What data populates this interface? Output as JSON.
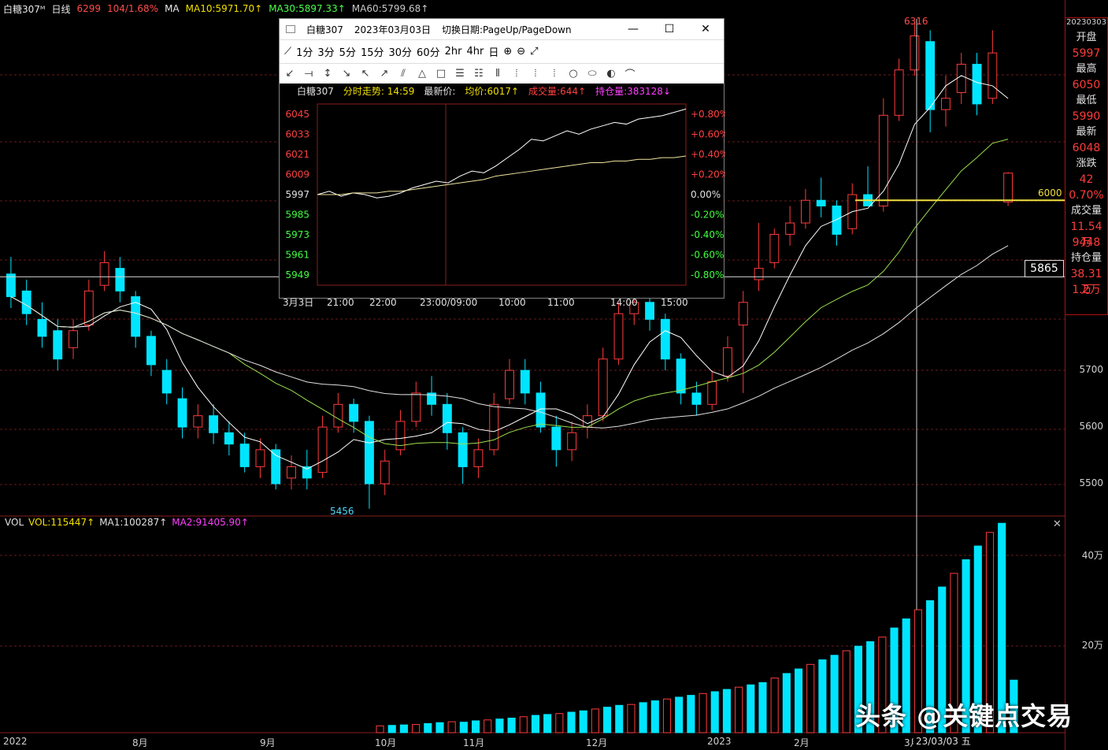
{
  "toolbar": {
    "symbol": "白糖307ᴹ",
    "period": "日线",
    "price": "6299",
    "change": "104/1.68%",
    "ma_label": "MA",
    "ma10": "MA10:5971.70↑",
    "ma30": "MA30:5897.33↑",
    "ma60": "MA60:5799.68↑"
  },
  "info_panel": {
    "date": "20230303",
    "open_label": "开盘",
    "open": "5997",
    "high_label": "最高",
    "high": "6050",
    "low_label": "最低",
    "low": "5990",
    "last_label": "最新",
    "last": "6048",
    "chg_label": "涨跌",
    "chg": "42",
    "pct": "0.70%",
    "vol_label": "成交量",
    "vol": "11.54万",
    "vol2": "9448",
    "oi_label": "持仓量",
    "oi": "38.31万",
    "oi2": "1.2万"
  },
  "price_axis": [
    "5700",
    "5600",
    "5500"
  ],
  "cursor_price": "5865",
  "level_label": "6000",
  "high_marker": "6316",
  "low_marker": "5456",
  "volume": {
    "label": "VOL",
    "vol": "VOL:115447↑",
    "ma1": "MA1:100287↑",
    "ma2": "MA2:91405.90↑",
    "axis": [
      "40万",
      "20万"
    ]
  },
  "x_axis": [
    "2022",
    "8月",
    "9月",
    "10月",
    "11月",
    "12月",
    "2023",
    "2月",
    "3月"
  ],
  "x_cursor": "23/03/03 五",
  "watermark": "头条 @关键点交易",
  "popup": {
    "title_symbol": "白糖307",
    "title_date": "2023年03月03日",
    "title_hint": "切换日期:PageUp/PageDown",
    "timeframes": [
      "1分",
      "3分",
      "5分",
      "15分",
      "30分",
      "60分",
      "2hr",
      "4hr",
      "日"
    ],
    "info_symbol": "白糖307",
    "info_trend": "分时走势: 14:59",
    "info_last": "最新价:",
    "info_avg": "均价:6017↑",
    "info_vol": "成交量:644↑",
    "info_oi": "持仓量:383128↓",
    "prices": [
      "6045",
      "6033",
      "6021",
      "6009",
      "5997",
      "5985",
      "5973",
      "5961",
      "5949"
    ],
    "pcts": [
      "+0.80%",
      "+0.60%",
      "+0.40%",
      "+0.20%",
      "0.00%",
      "-0.20%",
      "-0.40%",
      "-0.60%",
      "-0.80%"
    ],
    "times": [
      "3月3日",
      "21:00",
      "22:00",
      "23:00/09:00",
      "10:00",
      "11:00",
      "14:00",
      "15:00"
    ]
  },
  "colors": {
    "up": "#ff3b3b",
    "down": "#00e5ff",
    "ma10": "#ffffff",
    "ma30": "#9be04f",
    "ma60": "#e0e0e0",
    "level": "#f0e040"
  },
  "chart_data": {
    "type": "candlestick",
    "title": "白糖307",
    "period": "日线",
    "ylim": [
      5450,
      6320
    ],
    "series": [
      {
        "name": "K线",
        "values": [
          [
            5870,
            5830,
            5900,
            5810
          ],
          [
            5840,
            5800,
            5860,
            5780
          ],
          [
            5790,
            5760,
            5820,
            5740
          ],
          [
            5770,
            5720,
            5790,
            5700
          ],
          [
            5740,
            5770,
            5790,
            5720
          ],
          [
            5780,
            5840,
            5860,
            5770
          ],
          [
            5850,
            5890,
            5910,
            5840
          ],
          [
            5880,
            5840,
            5900,
            5820
          ],
          [
            5830,
            5760,
            5840,
            5740
          ],
          [
            5760,
            5710,
            5770,
            5690
          ],
          [
            5700,
            5660,
            5720,
            5640
          ],
          [
            5650,
            5600,
            5670,
            5580
          ],
          [
            5600,
            5620,
            5640,
            5580
          ],
          [
            5620,
            5590,
            5640,
            5570
          ],
          [
            5590,
            5570,
            5610,
            5550
          ],
          [
            5570,
            5530,
            5590,
            5520
          ],
          [
            5530,
            5560,
            5580,
            5510
          ],
          [
            5560,
            5500,
            5570,
            5490
          ],
          [
            5510,
            5530,
            5550,
            5490
          ],
          [
            5530,
            5510,
            5560,
            5490
          ],
          [
            5520,
            5600,
            5620,
            5510
          ],
          [
            5600,
            5640,
            5660,
            5590
          ],
          [
            5640,
            5610,
            5650,
            5590
          ],
          [
            5610,
            5500,
            5620,
            5456
          ],
          [
            5500,
            5540,
            5560,
            5480
          ],
          [
            5560,
            5610,
            5630,
            5550
          ],
          [
            5610,
            5660,
            5680,
            5600
          ],
          [
            5660,
            5640,
            5690,
            5620
          ],
          [
            5640,
            5590,
            5660,
            5560
          ],
          [
            5590,
            5530,
            5600,
            5500
          ],
          [
            5530,
            5560,
            5580,
            5510
          ],
          [
            5560,
            5640,
            5660,
            5550
          ],
          [
            5650,
            5700,
            5720,
            5640
          ],
          [
            5700,
            5660,
            5720,
            5640
          ],
          [
            5660,
            5600,
            5680,
            5590
          ],
          [
            5600,
            5560,
            5620,
            5530
          ],
          [
            5560,
            5590,
            5610,
            5540
          ],
          [
            5600,
            5620,
            5640,
            5580
          ],
          [
            5620,
            5720,
            5740,
            5610
          ],
          [
            5720,
            5800,
            5820,
            5710
          ],
          [
            5800,
            5820,
            5840,
            5780
          ],
          [
            5820,
            5790,
            5840,
            5770
          ],
          [
            5790,
            5720,
            5800,
            5700
          ],
          [
            5720,
            5660,
            5730,
            5640
          ],
          [
            5660,
            5640,
            5680,
            5620
          ],
          [
            5640,
            5680,
            5700,
            5630
          ],
          [
            5690,
            5740,
            5760,
            5680
          ],
          [
            5780,
            5820,
            5840,
            5660
          ],
          [
            5860,
            5880,
            5960,
            5840
          ],
          [
            5890,
            5940,
            5950,
            5880
          ],
          [
            5940,
            5960,
            5990,
            5920
          ],
          [
            5960,
            6000,
            6020,
            5950
          ],
          [
            6000,
            5990,
            6040,
            5970
          ],
          [
            5990,
            5940,
            6000,
            5920
          ],
          [
            5950,
            6010,
            6030,
            5940
          ],
          [
            6010,
            5990,
            6060,
            5990
          ],
          [
            5990,
            6150,
            6180,
            5980
          ],
          [
            6150,
            6230,
            6250,
            6140
          ],
          [
            6230,
            6290,
            6316,
            6220
          ],
          [
            6280,
            6160,
            6300,
            6120
          ],
          [
            6160,
            6180,
            6220,
            6130
          ],
          [
            6190,
            6240,
            6260,
            6170
          ],
          [
            6240,
            6170,
            6260,
            6150
          ],
          [
            6180,
            6260,
            6300,
            6170
          ],
          [
            5997,
            6048,
            6050,
            5990
          ]
        ]
      }
    ],
    "volume": [
      15000,
      16000,
      17000,
      18000,
      20000,
      22000,
      24000,
      23000,
      26000,
      28000,
      30000,
      32000,
      35000,
      38000,
      40000,
      42000,
      45000,
      48000,
      52000,
      56000,
      60000,
      62000,
      66000,
      70000,
      74000,
      78000,
      82000,
      86000,
      90000,
      95000,
      100000,
      105000,
      110000,
      120000,
      130000,
      140000,
      150000,
      160000,
      170000,
      180000,
      190000,
      200000,
      210000,
      230000,
      250000,
      270000,
      290000,
      320000,
      350000,
      380000,
      410000,
      440000,
      460000,
      115447
    ],
    "intraday": {
      "yclose": 5997,
      "ylim": [
        5943,
        6051
      ],
      "x": [
        "21:00",
        "22:00",
        "23:00/09:00",
        "10:00",
        "11:00",
        "14:00",
        "15:00"
      ],
      "price": [
        5997,
        5999,
        5996,
        5998,
        5997,
        5995,
        5996,
        5998,
        6001,
        6003,
        6005,
        6004,
        6008,
        6011,
        6010,
        6014,
        6019,
        6024,
        6030,
        6029,
        6032,
        6035,
        6033,
        6036,
        6038,
        6040,
        6039,
        6042,
        6043,
        6044,
        6046,
        6048
      ],
      "avg": [
        5997,
        5997,
        5997,
        5998,
        5998,
        5998,
        5999,
        5999,
        6000,
        6001,
        6002,
        6003,
        6004,
        6005,
        6006,
        6008,
        6009,
        6010,
        6011,
        6012,
        6013,
        6014,
        6015,
        6016,
        6016,
        6017,
        6017,
        6018,
        6018,
        6019,
        6019,
        6020
      ]
    }
  }
}
